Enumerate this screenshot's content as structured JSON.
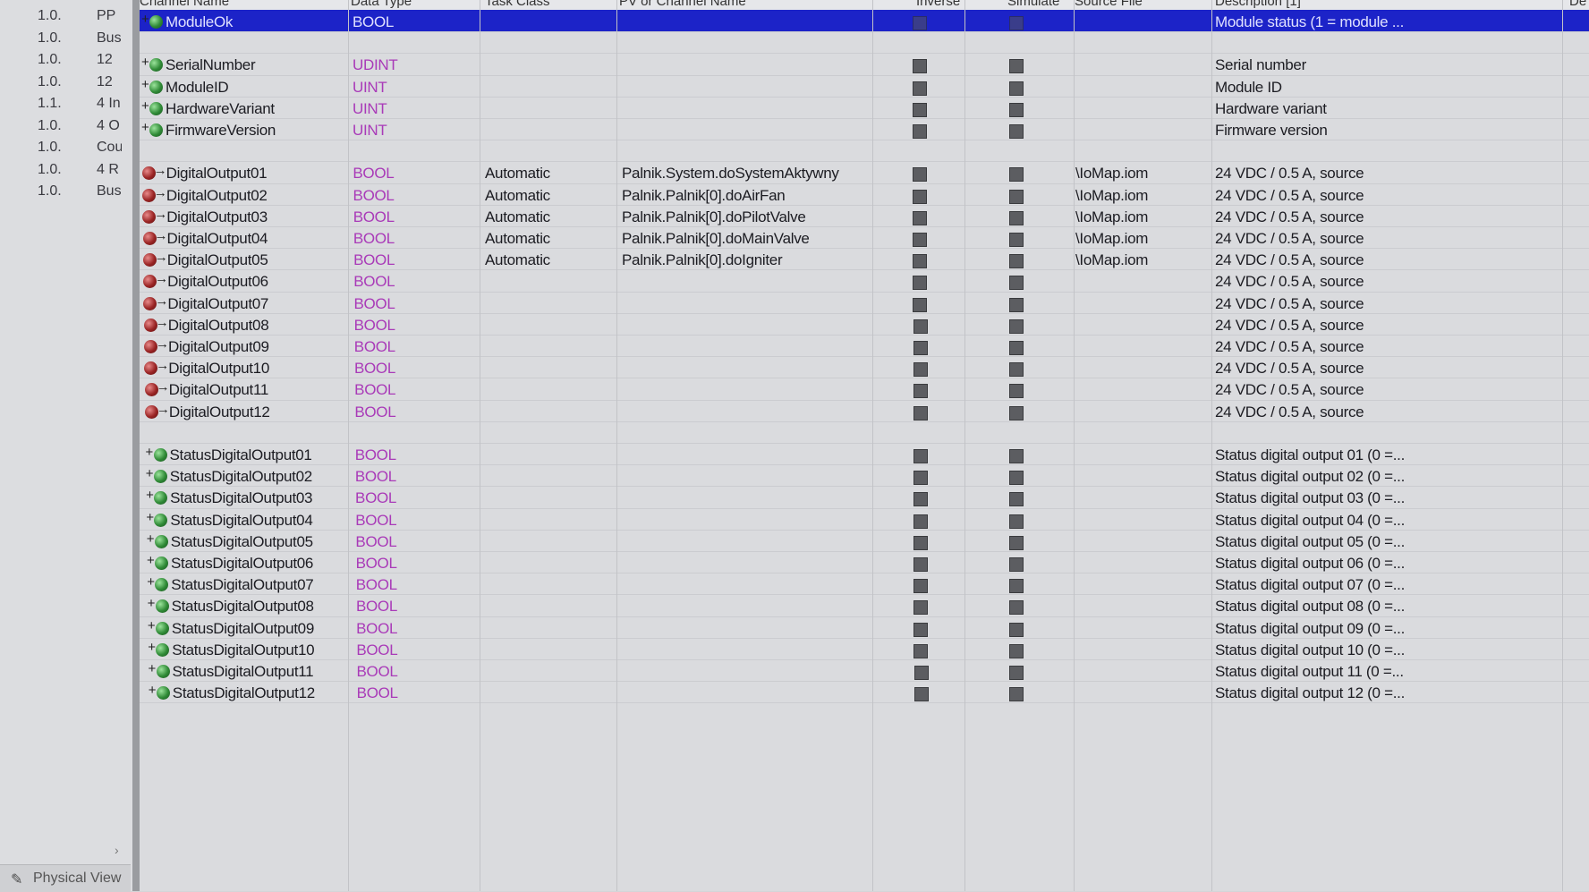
{
  "left_panel": {
    "rows": [
      {
        "version": "1.0.",
        "desc": "PP"
      },
      {
        "version": "1.0.",
        "desc": "Bus"
      },
      {
        "version": "1.0.",
        "desc": "12"
      },
      {
        "version": "1.0.",
        "desc": "12"
      },
      {
        "version": "1.1.",
        "desc": "4 In"
      },
      {
        "version": "1.0.",
        "desc": "4 O"
      },
      {
        "version": "1.0.",
        "desc": "Cou"
      },
      {
        "version": "1.0.",
        "desc": "4 R"
      },
      {
        "version": "1.0.",
        "desc": "Bus"
      }
    ],
    "scroll_arrow": "›",
    "physical_view_label": "Physical View"
  },
  "columns": {
    "channel_name": "Channel Name",
    "data_type": "Data Type",
    "task_class": "Task Class",
    "pv_or_channel_name": "PV or Channel Name",
    "inverse": "Inverse",
    "simulate": "Simulate",
    "source_file": "Source File",
    "description": "Description [1]",
    "extra": "De"
  },
  "rows": [
    {
      "icon": "green-in",
      "name": "ModuleOk",
      "type": "BOOL",
      "task": "",
      "pv": "",
      "source": "",
      "desc": "Module status (1 = module ...",
      "selected": true
    },
    {
      "icon": "",
      "name": "",
      "type": "",
      "task": "",
      "pv": "",
      "source": "",
      "desc": "",
      "blank": true
    },
    {
      "icon": "green-in",
      "name": "SerialNumber",
      "type": "UDINT",
      "task": "",
      "pv": "",
      "source": "",
      "desc": "Serial number"
    },
    {
      "icon": "green-in",
      "name": "ModuleID",
      "type": "UINT",
      "task": "",
      "pv": "",
      "source": "",
      "desc": "Module ID"
    },
    {
      "icon": "green-in",
      "name": "HardwareVariant",
      "type": "UINT",
      "task": "",
      "pv": "",
      "source": "",
      "desc": "Hardware variant"
    },
    {
      "icon": "green-in",
      "name": "FirmwareVersion",
      "type": "UINT",
      "task": "",
      "pv": "",
      "source": "",
      "desc": "Firmware version"
    },
    {
      "icon": "",
      "name": "",
      "type": "",
      "task": "",
      "pv": "",
      "source": "",
      "desc": "",
      "blank": true
    },
    {
      "icon": "red-out",
      "name": "DigitalOutput01",
      "type": "BOOL",
      "task": "Automatic",
      "pv": "Palnik.System.doSystemAktywny",
      "source": "\\IoMap.iom",
      "desc": "24 VDC / 0.5 A, source"
    },
    {
      "icon": "red-out",
      "name": "DigitalOutput02",
      "type": "BOOL",
      "task": "Automatic",
      "pv": "Palnik.Palnik[0].doAirFan",
      "source": "\\IoMap.iom",
      "desc": "24 VDC / 0.5 A, source"
    },
    {
      "icon": "red-out",
      "name": "DigitalOutput03",
      "type": "BOOL",
      "task": "Automatic",
      "pv": "Palnik.Palnik[0].doPilotValve",
      "source": "\\IoMap.iom",
      "desc": "24 VDC / 0.5 A, source"
    },
    {
      "icon": "red-out",
      "name": "DigitalOutput04",
      "type": "BOOL",
      "task": "Automatic",
      "pv": "Palnik.Palnik[0].doMainValve",
      "source": "\\IoMap.iom",
      "desc": "24 VDC / 0.5 A, source"
    },
    {
      "icon": "red-out",
      "name": "DigitalOutput05",
      "type": "BOOL",
      "task": "Automatic",
      "pv": "Palnik.Palnik[0].doIgniter",
      "source": "\\IoMap.iom",
      "desc": "24 VDC / 0.5 A, source"
    },
    {
      "icon": "red-out",
      "name": "DigitalOutput06",
      "type": "BOOL",
      "task": "",
      "pv": "",
      "source": "",
      "desc": "24 VDC / 0.5 A, source"
    },
    {
      "icon": "red-out",
      "name": "DigitalOutput07",
      "type": "BOOL",
      "task": "",
      "pv": "",
      "source": "",
      "desc": "24 VDC / 0.5 A, source"
    },
    {
      "icon": "red-out",
      "name": "DigitalOutput08",
      "type": "BOOL",
      "task": "",
      "pv": "",
      "source": "",
      "desc": "24 VDC / 0.5 A, source"
    },
    {
      "icon": "red-out",
      "name": "DigitalOutput09",
      "type": "BOOL",
      "task": "",
      "pv": "",
      "source": "",
      "desc": "24 VDC / 0.5 A, source"
    },
    {
      "icon": "red-out",
      "name": "DigitalOutput10",
      "type": "BOOL",
      "task": "",
      "pv": "",
      "source": "",
      "desc": "24 VDC / 0.5 A, source"
    },
    {
      "icon": "red-out",
      "name": "DigitalOutput11",
      "type": "BOOL",
      "task": "",
      "pv": "",
      "source": "",
      "desc": "24 VDC / 0.5 A, source"
    },
    {
      "icon": "red-out",
      "name": "DigitalOutput12",
      "type": "BOOL",
      "task": "",
      "pv": "",
      "source": "",
      "desc": "24 VDC / 0.5 A, source"
    },
    {
      "icon": "",
      "name": "",
      "type": "",
      "task": "",
      "pv": "",
      "source": "",
      "desc": "",
      "blank": true
    },
    {
      "icon": "green-in",
      "name": "StatusDigitalOutput01",
      "type": "BOOL",
      "task": "",
      "pv": "",
      "source": "",
      "desc": "Status digital output 01 (0 =..."
    },
    {
      "icon": "green-in",
      "name": "StatusDigitalOutput02",
      "type": "BOOL",
      "task": "",
      "pv": "",
      "source": "",
      "desc": "Status digital output 02 (0 =..."
    },
    {
      "icon": "green-in",
      "name": "StatusDigitalOutput03",
      "type": "BOOL",
      "task": "",
      "pv": "",
      "source": "",
      "desc": "Status digital output 03 (0 =..."
    },
    {
      "icon": "green-in",
      "name": "StatusDigitalOutput04",
      "type": "BOOL",
      "task": "",
      "pv": "",
      "source": "",
      "desc": "Status digital output 04 (0 =..."
    },
    {
      "icon": "green-in",
      "name": "StatusDigitalOutput05",
      "type": "BOOL",
      "task": "",
      "pv": "",
      "source": "",
      "desc": "Status digital output 05 (0 =..."
    },
    {
      "icon": "green-in",
      "name": "StatusDigitalOutput06",
      "type": "BOOL",
      "task": "",
      "pv": "",
      "source": "",
      "desc": "Status digital output 06 (0 =..."
    },
    {
      "icon": "green-in",
      "name": "StatusDigitalOutput07",
      "type": "BOOL",
      "task": "",
      "pv": "",
      "source": "",
      "desc": "Status digital output 07 (0 =..."
    },
    {
      "icon": "green-in",
      "name": "StatusDigitalOutput08",
      "type": "BOOL",
      "task": "",
      "pv": "",
      "source": "",
      "desc": "Status digital output 08 (0 =..."
    },
    {
      "icon": "green-in",
      "name": "StatusDigitalOutput09",
      "type": "BOOL",
      "task": "",
      "pv": "",
      "source": "",
      "desc": "Status digital output 09 (0 =..."
    },
    {
      "icon": "green-in",
      "name": "StatusDigitalOutput10",
      "type": "BOOL",
      "task": "",
      "pv": "",
      "source": "",
      "desc": "Status digital output 10 (0 =..."
    },
    {
      "icon": "green-in",
      "name": "StatusDigitalOutput11",
      "type": "BOOL",
      "task": "",
      "pv": "",
      "source": "",
      "desc": "Status digital output 11 (0 =..."
    },
    {
      "icon": "green-in",
      "name": "StatusDigitalOutput12",
      "type": "BOOL",
      "task": "",
      "pv": "",
      "source": "",
      "desc": "Status digital output 12 (0 =..."
    }
  ],
  "colors": {
    "selection": "#1c23c8",
    "data_type_text": "#a93ab8",
    "input_icon": "#2f8a36",
    "output_icon": "#9a2424"
  }
}
